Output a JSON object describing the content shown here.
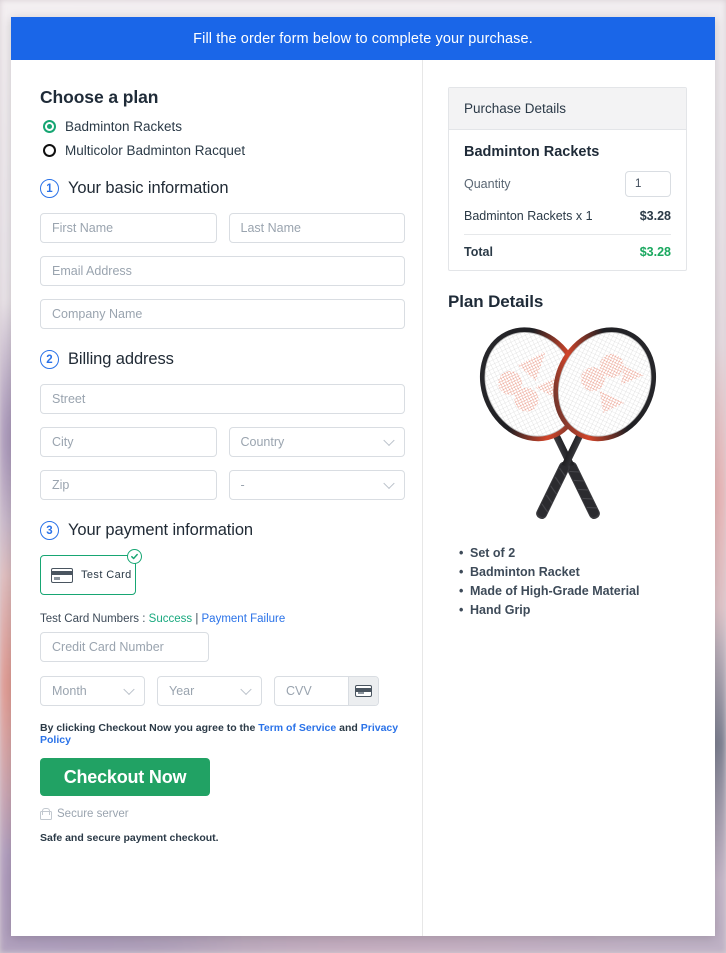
{
  "banner": {
    "text": "Fill the order form below to complete your purchase."
  },
  "plan": {
    "heading": "Choose a plan",
    "options": [
      {
        "label": "Badminton Rackets",
        "selected": true
      },
      {
        "label": "Multicolor Badminton Racquet",
        "selected": false
      }
    ]
  },
  "steps": {
    "basic": {
      "number": "1",
      "title": "Your basic information"
    },
    "billing": {
      "number": "2",
      "title": "Billing address"
    },
    "payment": {
      "number": "3",
      "title": "Your payment information"
    }
  },
  "basic_fields": {
    "first_name": "First Name",
    "last_name": "Last Name",
    "email": "Email Address",
    "company": "Company Name"
  },
  "billing_fields": {
    "street": "Street",
    "city": "City",
    "country": "Country",
    "zip": "Zip",
    "state": "-"
  },
  "payment": {
    "test_card_label": "Test Card",
    "card_icon": "credit-card-icon",
    "check_icon": "check-circle-icon",
    "test_numbers_prefix": "Test Card Numbers : ",
    "success_link": "Success",
    "separator": " | ",
    "failure_link": "Payment Failure",
    "cc_number": "Credit Card Number",
    "month": "Month",
    "year": "Year",
    "cvv": "CVV",
    "cvv_icon": "credit-card-icon"
  },
  "terms": {
    "before": "By clicking Checkout Now you agree to the ",
    "tos": "Term of Service",
    "middle": " and ",
    "privacy": "Privacy Policy"
  },
  "checkout": {
    "label": "Checkout Now"
  },
  "secure": {
    "icon": "lock-icon",
    "label": "Secure server",
    "note": "Safe and secure payment checkout."
  },
  "purchase": {
    "header": "Purchase Details",
    "product": "Badminton Rackets",
    "quantity_label": "Quantity",
    "quantity_value": "1",
    "line_item_name": "Badminton Rackets x 1",
    "line_item_price": "$3.28",
    "total_label": "Total",
    "total_value": "$3.28"
  },
  "plan_details": {
    "title": "Plan Details",
    "image_name": "badminton-rackets-product-image",
    "features": [
      "Set of 2",
      "Badminton Racket",
      "Made of High-Grade Material",
      "Hand Grip"
    ]
  },
  "colors": {
    "banner_blue": "#1a66e8",
    "accent_green": "#17a673",
    "button_green": "#21a264",
    "total_green": "#1aa85f",
    "link_blue": "#2a72e8",
    "step_blue": "#2a72e8"
  }
}
